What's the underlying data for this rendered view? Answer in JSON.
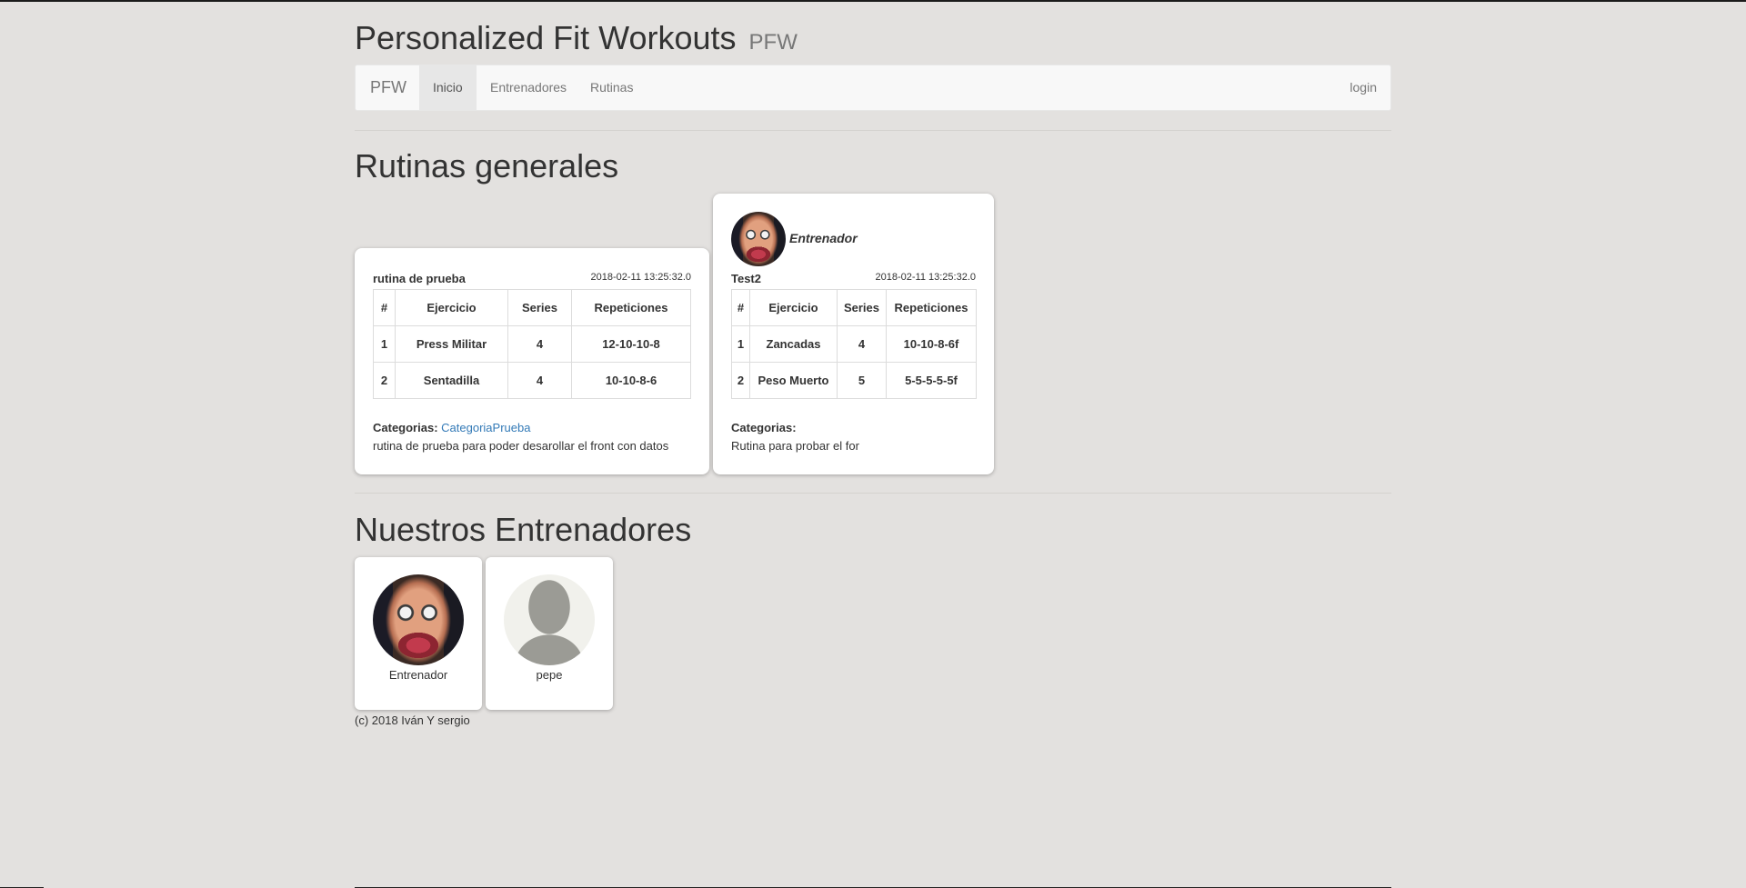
{
  "header": {
    "title": "Personalized Fit Workouts",
    "subtitle": "PFW"
  },
  "navbar": {
    "brand": "PFW",
    "items": [
      {
        "label": "Inicio",
        "active": true
      },
      {
        "label": "Entrenadores",
        "active": false
      },
      {
        "label": "Rutinas",
        "active": false
      }
    ],
    "login": "login"
  },
  "routines_section": {
    "title": "Rutinas generales",
    "columns": [
      "#",
      "Ejercicio",
      "Series",
      "Repeticiones"
    ],
    "categories_label": "Categorias:",
    "routines": [
      {
        "name": "rutina de prueba",
        "date": "2018-02-11 13:25:32.0",
        "author": "",
        "rows": [
          {
            "n": "1",
            "exercise": "Press Militar",
            "series": "4",
            "reps": "12-10-10-8"
          },
          {
            "n": "2",
            "exercise": "Sentadilla",
            "series": "4",
            "reps": "10-10-8-6"
          }
        ],
        "category": "CategoriaPrueba",
        "description": "rutina de prueba para poder desarollar el front con datos"
      },
      {
        "name": "Test2",
        "date": "2018-02-11 13:25:32.0",
        "author": "Entrenador",
        "rows": [
          {
            "n": "1",
            "exercise": "Zancadas",
            "series": "4",
            "reps": "10-10-8-6f"
          },
          {
            "n": "2",
            "exercise": "Peso Muerto",
            "series": "5",
            "reps": "5-5-5-5-5f"
          }
        ],
        "category": "",
        "description": "Rutina para probar el for"
      }
    ]
  },
  "trainers_section": {
    "title": "Nuestros Entrenadores",
    "trainers": [
      {
        "name": "Entrenador",
        "avatar": "photo"
      },
      {
        "name": "pepe",
        "avatar": "default-silhouette"
      }
    ]
  },
  "footer": {
    "text": "(c) 2018 Iván Y sergio"
  },
  "colors": {
    "background": "#e3e1df",
    "navbar_bg": "#f8f8f8",
    "link": "#337ab7",
    "text": "#333333"
  }
}
